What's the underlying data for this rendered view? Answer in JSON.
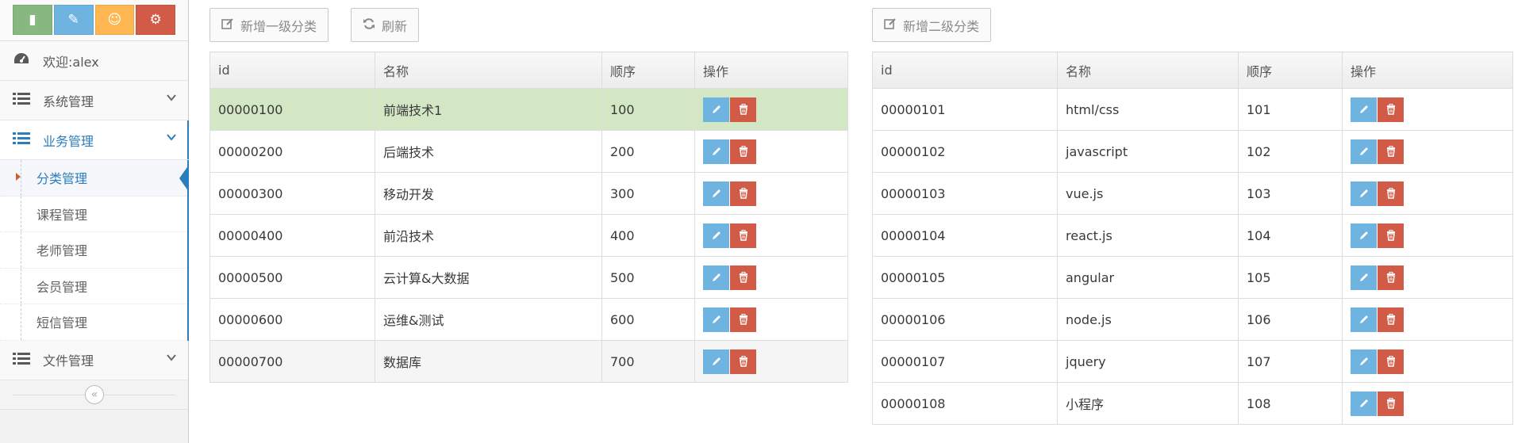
{
  "shortcuts": [
    {
      "icon": "signal-icon",
      "glyph": "▮",
      "color": "#87b87f"
    },
    {
      "icon": "pencil-icon",
      "glyph": "✎",
      "color": "#6fb3e0"
    },
    {
      "icon": "users-icon",
      "glyph": "☺",
      "color": "#ffb752"
    },
    {
      "icon": "cogs-icon",
      "glyph": "⚙",
      "color": "#d15b47"
    }
  ],
  "sidebar": {
    "welcome": "欢迎:alex",
    "items": [
      {
        "label": "系统管理"
      },
      {
        "label": "业务管理"
      },
      {
        "label": "文件管理"
      }
    ],
    "submenu": [
      "分类管理",
      "课程管理",
      "老师管理",
      "会员管理",
      "短信管理"
    ],
    "collapse_glyph": "«"
  },
  "toolbar": {
    "add_level1": "新增一级分类",
    "refresh": "刷新",
    "add_level2": "新增二级分类"
  },
  "table1": {
    "headers": [
      "id",
      "名称",
      "顺序",
      "操作"
    ],
    "rows": [
      [
        "00000100",
        "前端技术1",
        "100"
      ],
      [
        "00000200",
        "后端技术",
        "200"
      ],
      [
        "00000300",
        "移动开发",
        "300"
      ],
      [
        "00000400",
        "前沿技术",
        "400"
      ],
      [
        "00000500",
        "云计算&大数据",
        "500"
      ],
      [
        "00000600",
        "运维&测试",
        "600"
      ],
      [
        "00000700",
        "数据库",
        "700"
      ]
    ]
  },
  "table2": {
    "headers": [
      "id",
      "名称",
      "顺序",
      "操作"
    ],
    "rows": [
      [
        "00000101",
        "html/css",
        "101"
      ],
      [
        "00000102",
        "javascript",
        "102"
      ],
      [
        "00000103",
        "vue.js",
        "103"
      ],
      [
        "00000104",
        "react.js",
        "104"
      ],
      [
        "00000105",
        "angular",
        "105"
      ],
      [
        "00000106",
        "node.js",
        "106"
      ],
      [
        "00000107",
        "jquery",
        "107"
      ],
      [
        "00000108",
        "小程序",
        "108"
      ]
    ]
  },
  "colors": {
    "accent": "#2b7dbc",
    "edit": "#6fb3e0",
    "delete": "#d15b47",
    "selected_row": "#d4e7c5"
  }
}
